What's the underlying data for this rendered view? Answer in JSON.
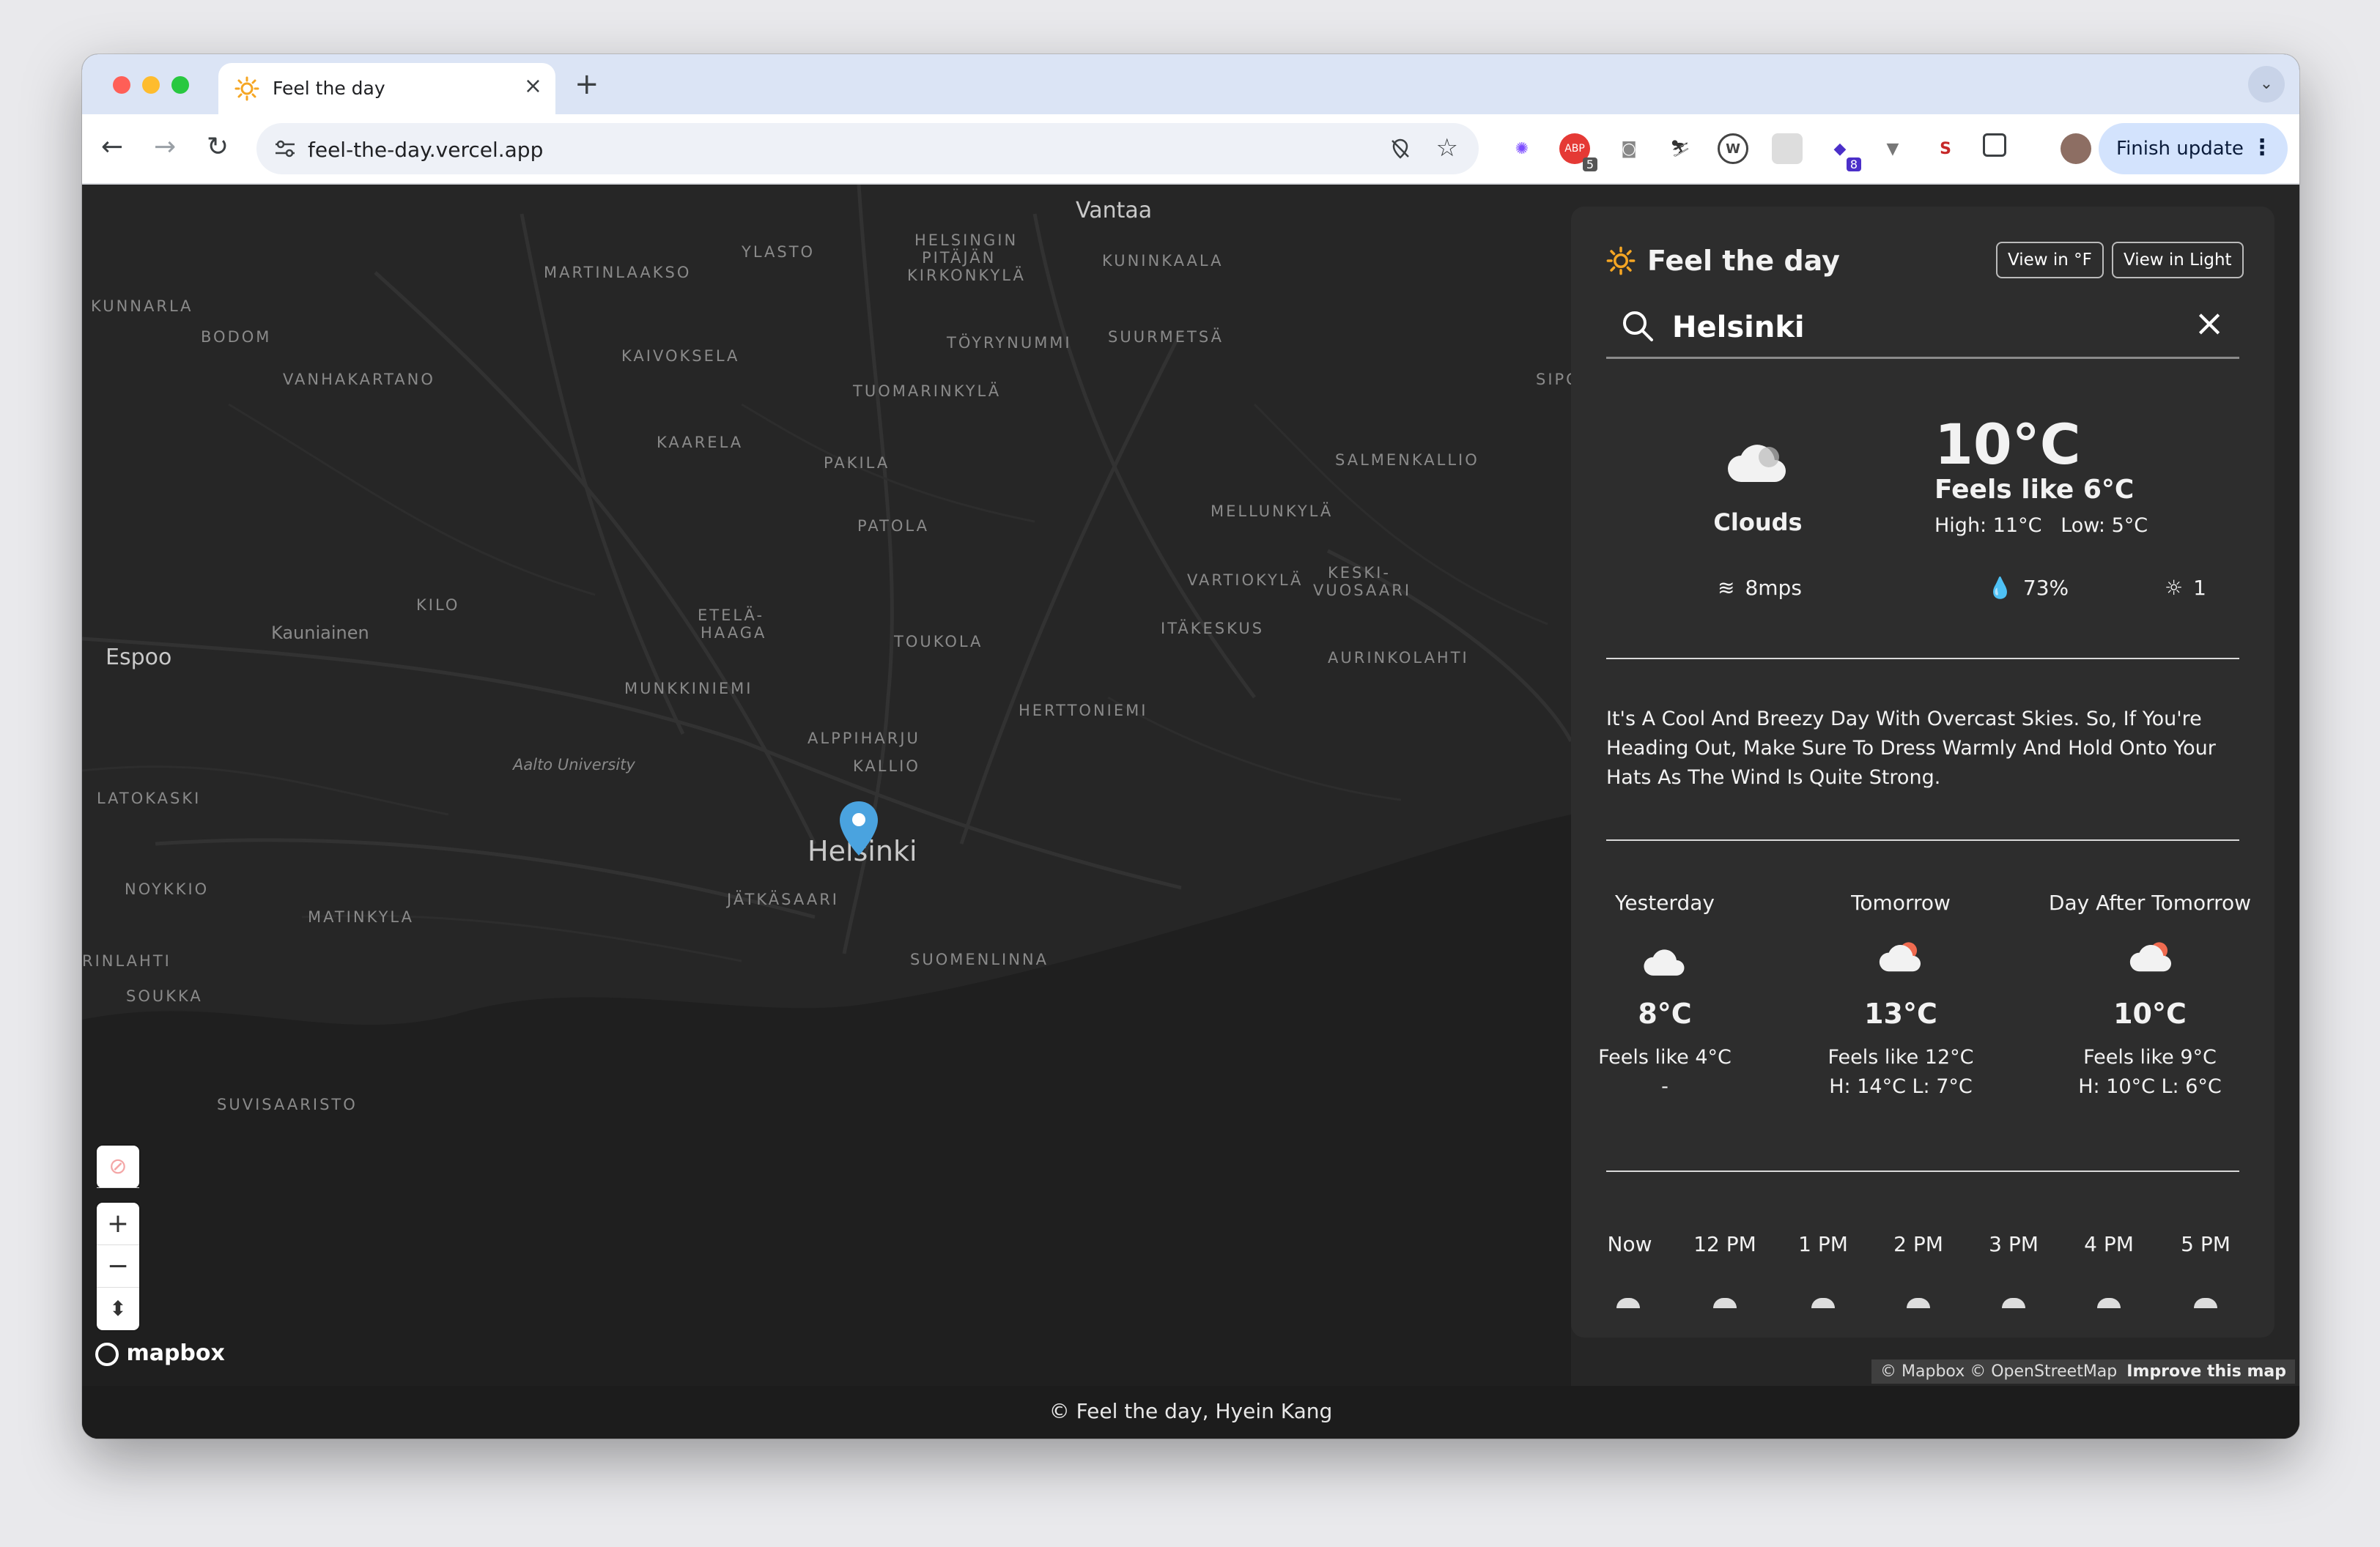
{
  "browser": {
    "tab_title": "Feel the day",
    "url": "feel-the-day.vercel.app",
    "finish_update": "Finish update",
    "ext_badges": [
      "5",
      "8"
    ]
  },
  "map": {
    "labels": [
      "Vantaa",
      "YLASTO",
      "HELSINGIN",
      "PITÄJÄN",
      "KIRKONKYLÄ",
      "KUNINKAALA",
      "MARTINLAAKSO",
      "KUNNARLA",
      "BODOM",
      "TÖYRYNUMMI",
      "SUURMETSÄ",
      "KAIVOKSELA",
      "VANHAKARTANO",
      "TUOMARINKYLÄ",
      "SIPO",
      "KAARELA",
      "PAKILA",
      "SALMENKALLIO",
      "PATOLA",
      "MELLUNKYLÄ",
      "VARTIOKYLÄ",
      "KESKI-",
      "VUOSAARI",
      "KILO",
      "ETELÄ-",
      "HAAGA",
      "Espoo",
      "Kauniainen",
      "TOUKOLA",
      "ITÄKESKUS",
      "AURINKOLAHTI",
      "MUNKKINIEMI",
      "HERTTONIEMI",
      "ALPPIHARJU",
      "Aalto University",
      "KALLIO",
      "LATOKASKI",
      "Helsinki",
      "JÄTKÄSAARI",
      "NOYKKIO",
      "MATINKYLA",
      "SUOMENLINNA",
      "RINLAHTI",
      "SOUKKA",
      "SUVISAARISTO"
    ],
    "logo": "mapbox",
    "attribution": "© Mapbox © OpenStreetMap",
    "improve": "Improve this map"
  },
  "panel": {
    "title": "Feel the day",
    "view_f": "View in °F",
    "view_light": "View in Light",
    "search_value": "Helsinki",
    "current": {
      "temp": "10°C",
      "condition": "Clouds",
      "feels": "Feels like 6°C",
      "high": "High: 11°C",
      "low": "Low: 5°C",
      "wind": "8mps",
      "humidity": "73%",
      "uv": "1"
    },
    "description": "It's A Cool And Breezy Day With Overcast Skies. So, If You're Heading Out, Make Sure To Dress Warmly And Hold Onto Your Hats As The Wind Is Quite Strong.",
    "days": [
      {
        "label": "Yesterday",
        "temp": "8°C",
        "feels": "Feels like 4°C",
        "hl": "-"
      },
      {
        "label": "Tomorrow",
        "temp": "13°C",
        "feels": "Feels like 12°C",
        "hl": "H: 14°C L: 7°C"
      },
      {
        "label": "Day After Tomorrow",
        "temp": "10°C",
        "feels": "Feels like 9°C",
        "hl": "H: 10°C L: 6°C"
      }
    ],
    "hours": [
      "Now",
      "12 PM",
      "1 PM",
      "2 PM",
      "3 PM",
      "4 PM",
      "5 PM"
    ]
  },
  "footer": "© Feel the day, Hyein Kang",
  "colors": {
    "accent": "#f5a623",
    "pin": "#4aa3df",
    "panel": "#2d2d2d",
    "map": "#232323"
  }
}
